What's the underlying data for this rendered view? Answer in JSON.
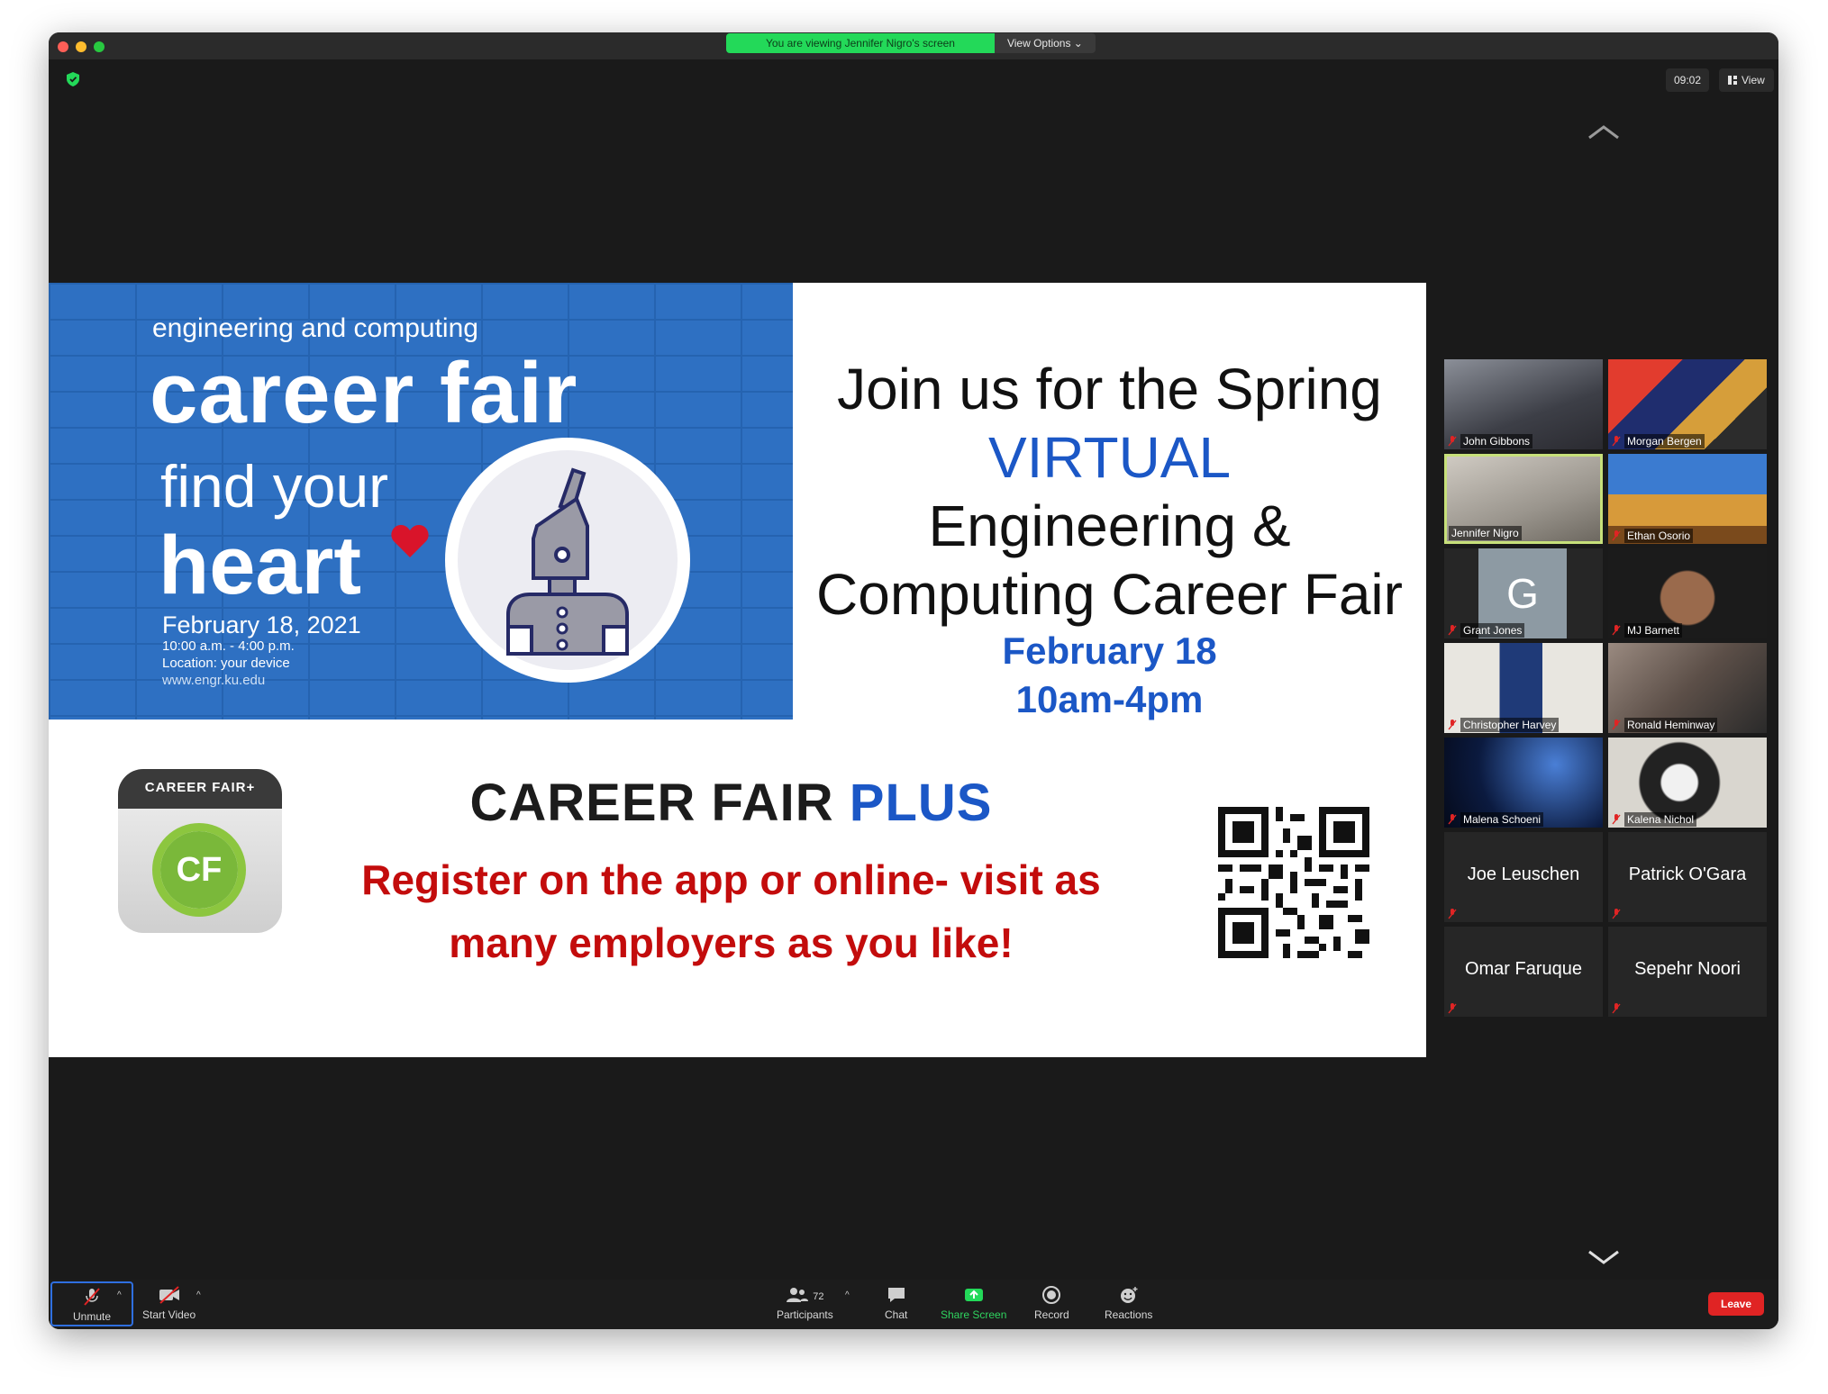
{
  "titlebar": {
    "viewing_banner": "You are viewing Jennifer Nigro's screen",
    "view_options": "View Options"
  },
  "top_right": {
    "clock": "09:02",
    "view_label": "View"
  },
  "slide": {
    "career_fair_subtitle": "engineering and computing",
    "career_fair_title": "career fair",
    "find_your": "find your",
    "heart_word": "heart",
    "event_date": "February 18, 2021",
    "event_time": "10:00 a.m. - 4:00 p.m.",
    "event_location": "Location: your device",
    "event_url": "www.engr.ku.edu",
    "join_line1": "Join us for the Spring",
    "join_line2": "VIRTUAL",
    "join_line3": "Engineering &",
    "join_line4": "Computing Career Fair",
    "join_date": "February 18",
    "join_time": "10am-4pm",
    "app_label": "CAREER FAIR+",
    "app_initials": "CF",
    "cfp_main": "CAREER FAIR",
    "cfp_plus": "PLUS",
    "register_line1": "Register on the app or online- visit as",
    "register_line2": "many employers as you like!"
  },
  "participants_gallery": [
    {
      "name": "John Gibbons"
    },
    {
      "name": "Morgan Bergen"
    },
    {
      "name": "Jennifer Nigro"
    },
    {
      "name": "Ethan Osorio"
    },
    {
      "name": "Grant Jones",
      "initial": "G"
    },
    {
      "name": "MJ Barnett"
    },
    {
      "name": "Christopher Harvey"
    },
    {
      "name": "Ronald Heminway"
    },
    {
      "name": "Malena Schoeni"
    },
    {
      "name": "Kalena Nichol"
    },
    {
      "name": "Joe Leuschen"
    },
    {
      "name": "Patrick O'Gara"
    },
    {
      "name": "Omar Faruque"
    },
    {
      "name": "Sepehr Noori"
    }
  ],
  "toolbar": {
    "unmute": "Unmute",
    "start_video": "Start Video",
    "participants": "Participants",
    "participants_count": "72",
    "chat": "Chat",
    "share_screen": "Share Screen",
    "record": "Record",
    "reactions": "Reactions",
    "leave": "Leave"
  },
  "colors": {
    "share_green": "#23d959",
    "leave_red": "#e02424",
    "slide_blue": "#2e70c2",
    "register_red": "#c30c0c",
    "accent_blue": "#1b57c6"
  },
  "icons": [
    "shield-icon",
    "view-grid-icon",
    "chevron-up-icon",
    "chevron-down-icon",
    "mic-muted-icon",
    "video-off-icon",
    "participants-icon",
    "chat-icon",
    "share-screen-icon",
    "record-icon",
    "reactions-icon",
    "heart-icon",
    "robot-icon",
    "qr-code"
  ]
}
